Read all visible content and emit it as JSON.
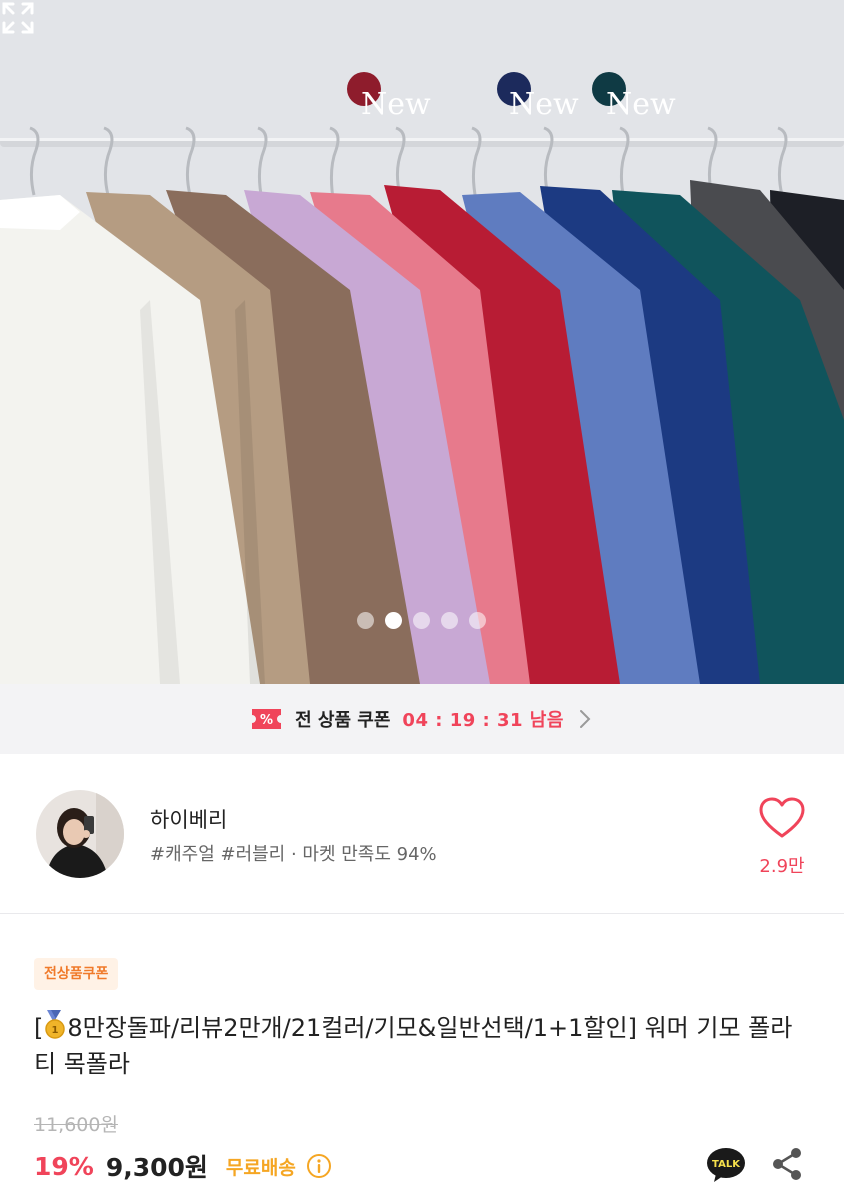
{
  "hero": {
    "badges": [
      "New",
      "New",
      "New"
    ],
    "slide_count": 5,
    "active_slide": 1
  },
  "coupon_bar": {
    "label": "전 상품 쿠폰",
    "timer": "04 : 19 : 31 남음",
    "icon": "coupon-icon"
  },
  "store": {
    "name": "하이베리",
    "tags": "#캐주얼 #러블리 · 마켓 만족도 94%",
    "likes": "2.9만"
  },
  "product": {
    "chip": "전상품쿠폰",
    "title_open": "[",
    "title_rest": "8만장돌파/리뷰2만개/21컬러/기모&일반선택/1+1할인] 워머 기모 폴라티 목폴라",
    "original_price": "11,600원",
    "discount": "19%",
    "price": "9,300원",
    "shipping": "무료배송",
    "talk_label": "TALK"
  },
  "colors": {
    "accent": "#f0445a",
    "shipping": "#f5a623"
  }
}
